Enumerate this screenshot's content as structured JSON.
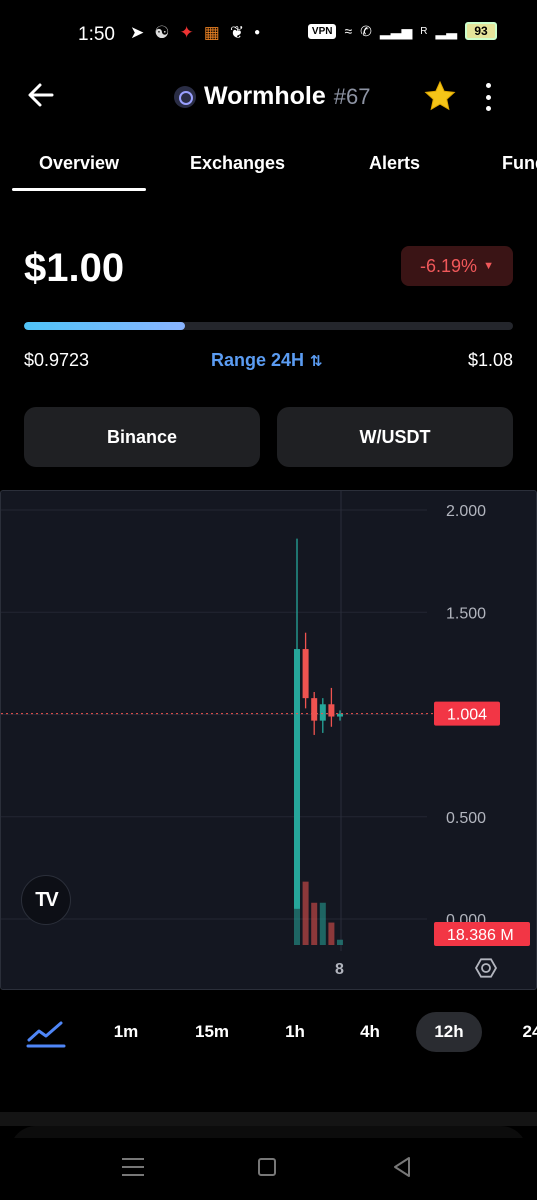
{
  "status_bar": {
    "time": "1:50",
    "left_icons": [
      "telegram-icon",
      "app-icon",
      "app-icon",
      "app-icon",
      "app-icon",
      "dot-icon"
    ],
    "vpn": "VPN",
    "signal_label": "R",
    "battery": "93"
  },
  "header": {
    "coin_name": "Wormhole",
    "rank": "#67"
  },
  "tabs": [
    "Overview",
    "Exchanges",
    "Alerts",
    "Fund"
  ],
  "price": {
    "value": "$1.00",
    "change": "-6.19%",
    "change_color": "#f0585a"
  },
  "range": {
    "low": "$0.9723",
    "label": "Range 24H",
    "high": "$1.08",
    "position": 0.33
  },
  "exchange": {
    "name": "Binance",
    "pair": "W/USDT"
  },
  "chart_data": {
    "type": "candlestick",
    "y_ticks": [
      "2.000",
      "1.500",
      "0.500",
      "0.000"
    ],
    "ylim": [
      0,
      2.1
    ],
    "last_price": "1.004",
    "last_price_value": 1.004,
    "volume_label": "18.386 M",
    "x_label": "8",
    "up_color": "#26a69a",
    "down_color": "#ef5350",
    "candles": [
      {
        "open": 0.05,
        "close": 1.32,
        "high": 1.86,
        "low": 0.05
      },
      {
        "open": 1.32,
        "close": 1.08,
        "high": 1.4,
        "low": 1.03
      },
      {
        "open": 1.08,
        "close": 0.97,
        "high": 1.11,
        "low": 0.9
      },
      {
        "open": 0.97,
        "close": 1.05,
        "high": 1.08,
        "low": 0.91
      },
      {
        "open": 1.05,
        "close": 0.99,
        "high": 1.13,
        "low": 0.94
      },
      {
        "open": 0.99,
        "close": 1.004,
        "high": 1.02,
        "low": 0.97
      }
    ],
    "volumes": [
      1.0,
      0.96,
      0.64,
      0.64,
      0.34,
      0.08
    ]
  },
  "intervals": {
    "items": [
      "1m",
      "15m",
      "1h",
      "4h",
      "12h",
      "24"
    ],
    "active": "12h"
  }
}
